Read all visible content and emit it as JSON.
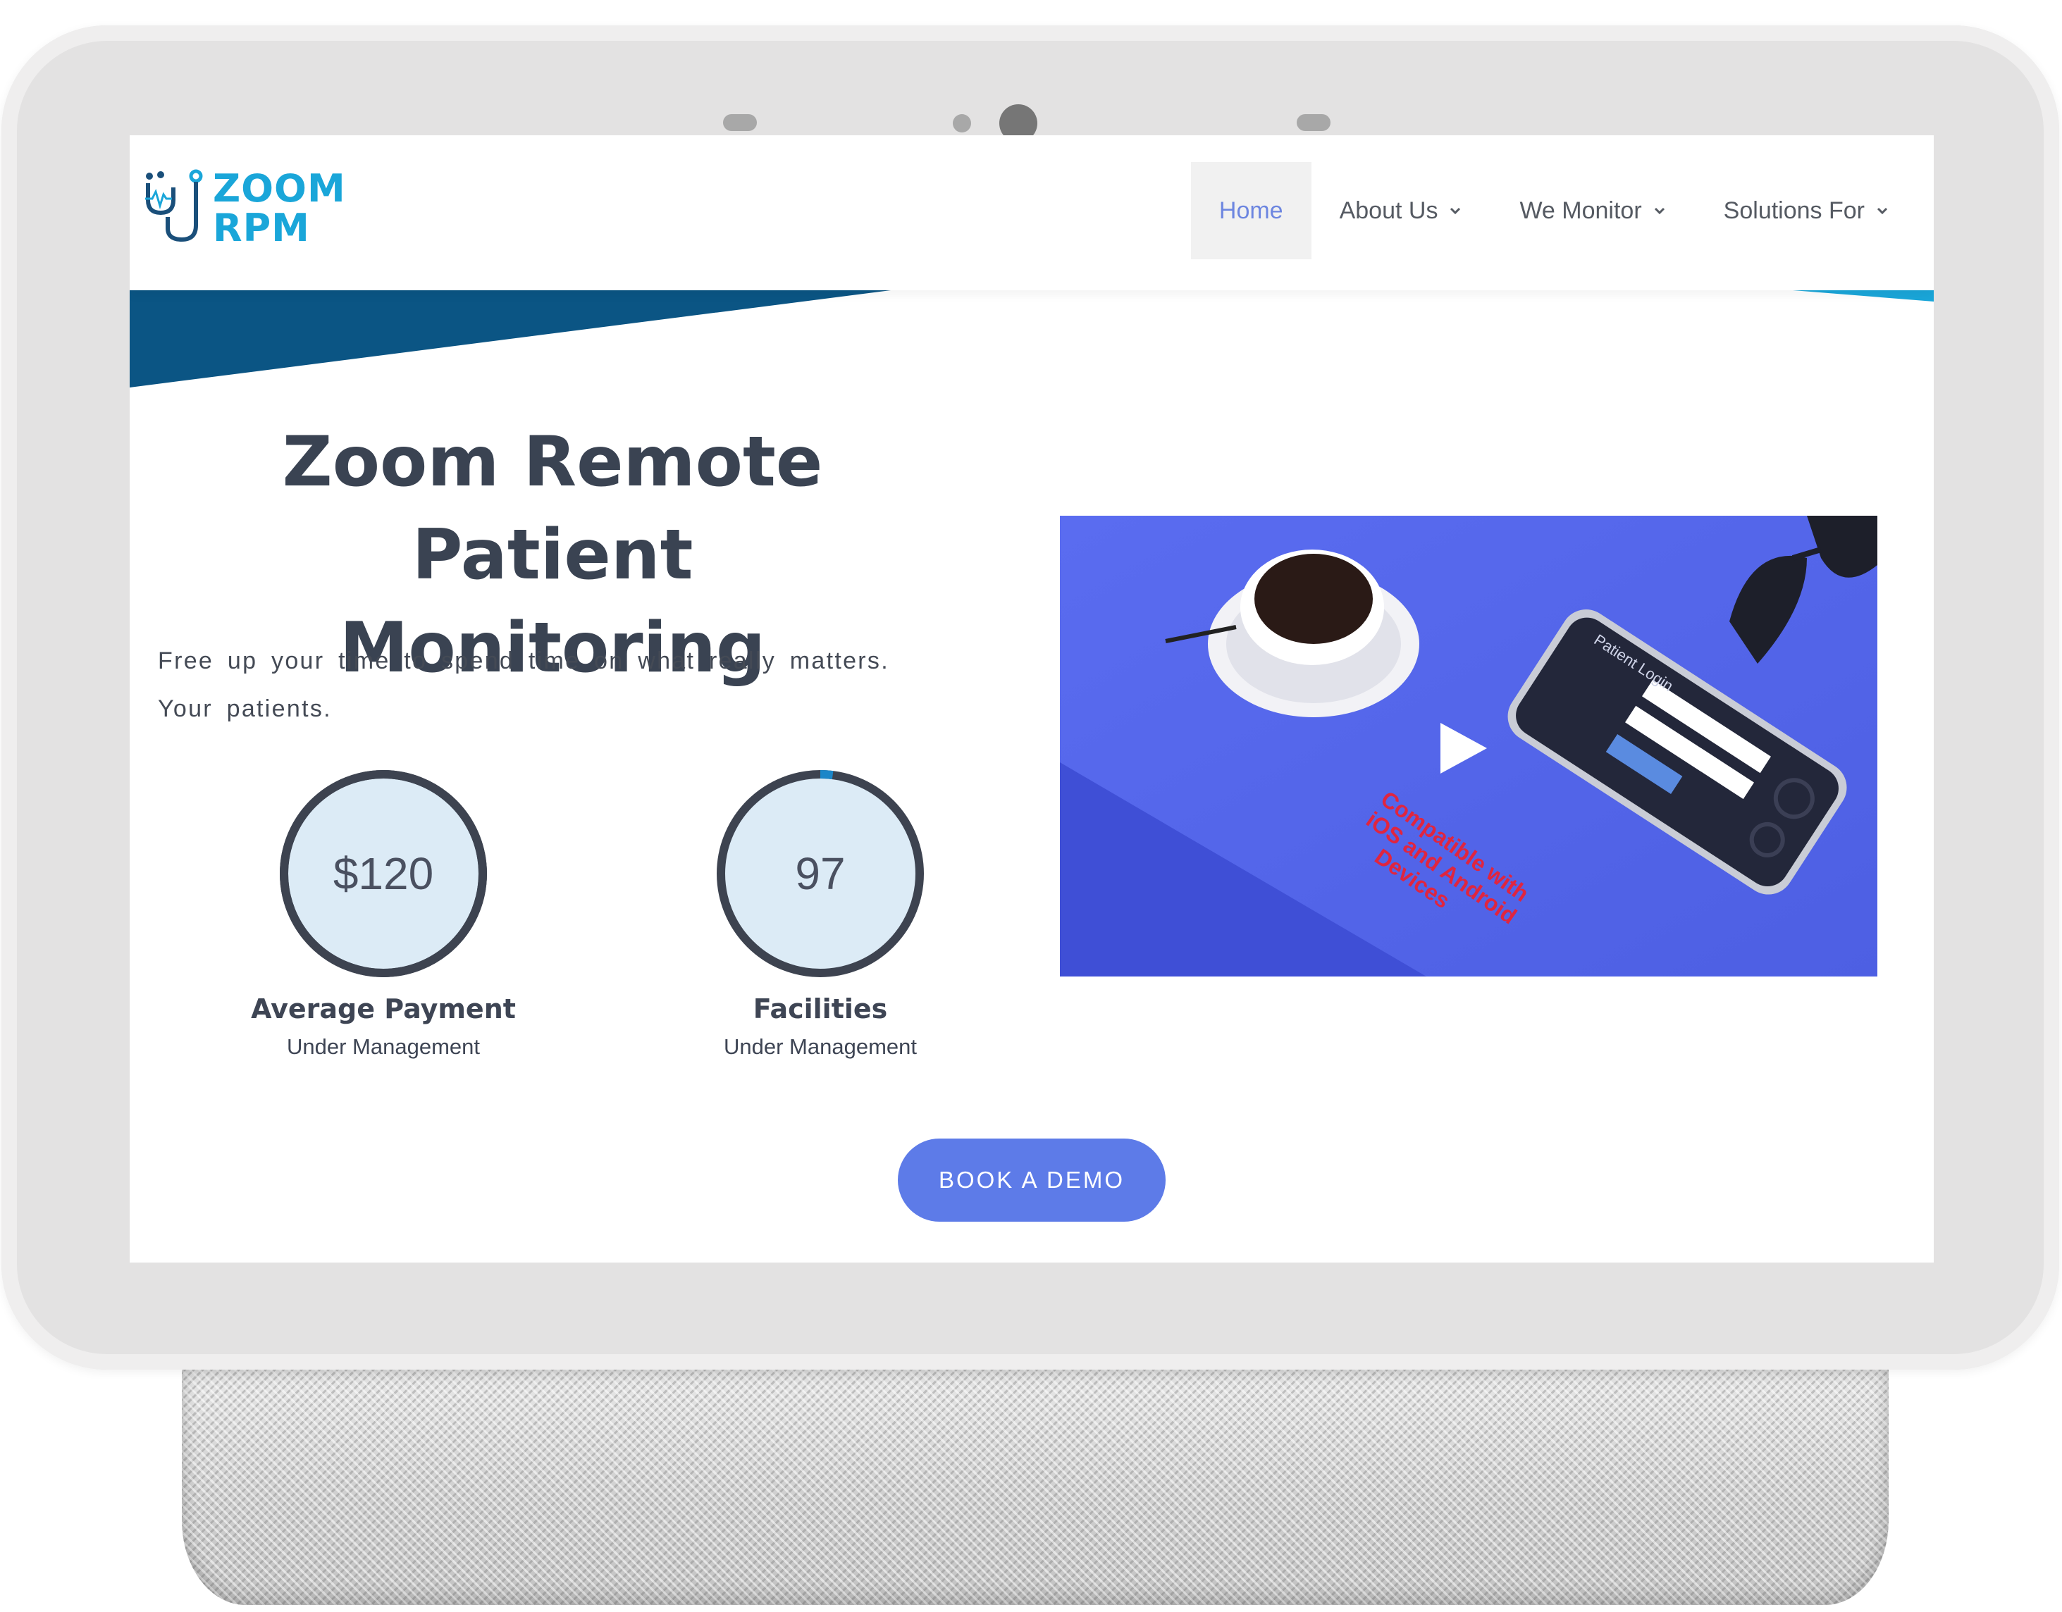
{
  "brand": {
    "logo_line1": "ZOOM",
    "logo_line2": "RPM",
    "logo_color": "#1aa6d9"
  },
  "nav": {
    "items": [
      {
        "label": "Home",
        "active": true,
        "dropdown": false
      },
      {
        "label": "About Us",
        "active": false,
        "dropdown": true
      },
      {
        "label": "We Monitor",
        "active": false,
        "dropdown": true
      },
      {
        "label": "Solutions For",
        "active": false,
        "dropdown": true
      }
    ],
    "active_color": "#6d86e0"
  },
  "hero": {
    "title_line1": "Zoom Remote Patient",
    "title_line2": "Monitoring",
    "subtitle": "Free up your time to spend time on what really matters. Your patients."
  },
  "stats": [
    {
      "value": "$120",
      "label": "Average Payment",
      "sublabel": "Under Management",
      "progress": 1.0
    },
    {
      "value": "97",
      "label": "Facilities",
      "sublabel": "Under Management",
      "progress": 0.02
    }
  ],
  "video": {
    "app_screen_title": "Patient Login",
    "caption_line1": "Compatible with",
    "caption_line2": "iOS and Android",
    "caption_line3": "Devices",
    "background_color": "#4f64e6",
    "play_icon": "play-icon"
  },
  "cta": {
    "label": "BOOK A DEMO",
    "color": "#5d7be8"
  },
  "theme": {
    "heading_color": "#3a4352",
    "band_dark": "#0b5584",
    "band_light": "#1aa6d9",
    "ring_color": "#3d4350",
    "ring_fill": "#dcebf6"
  }
}
